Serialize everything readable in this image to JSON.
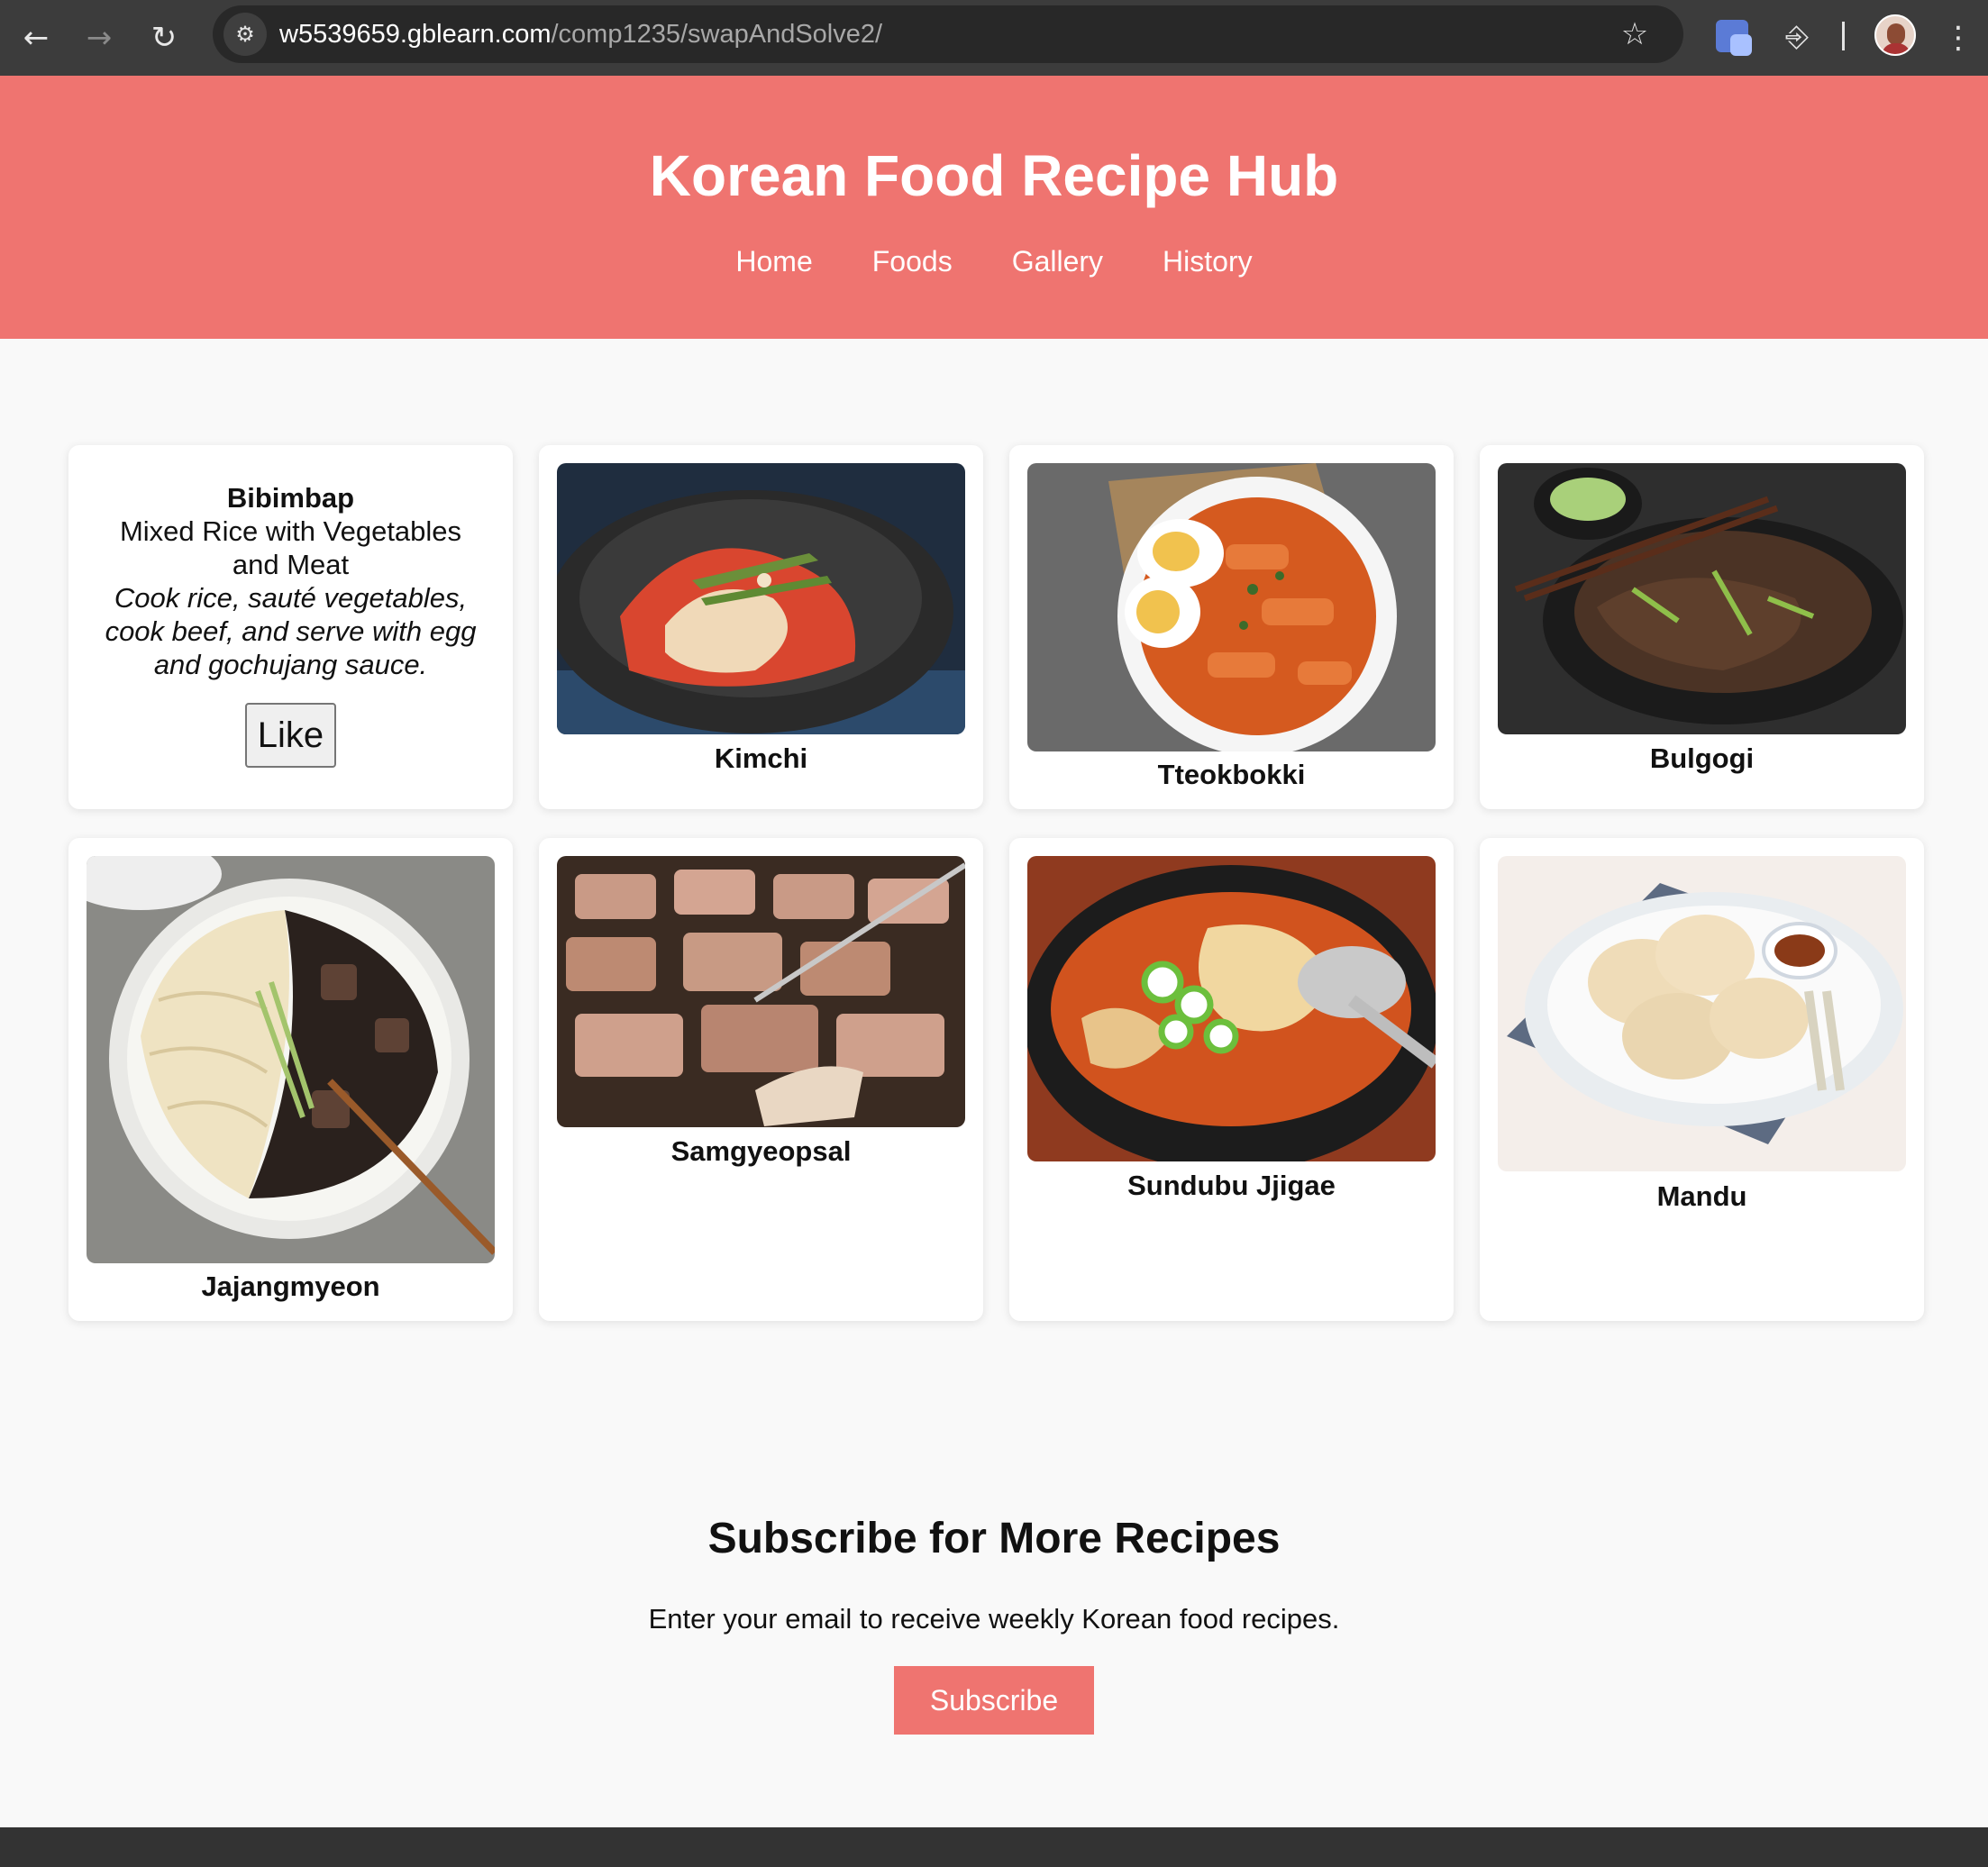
{
  "browser": {
    "url_host": "w5539659.gblearn.com",
    "url_path": "/comp1235/swapAndSolve2/",
    "back_icon": "arrow-left-icon",
    "forward_icon": "arrow-right-icon",
    "reload_icon": "reload-icon",
    "site_info_icon": "tune-icon",
    "bookmark_icon": "star-icon",
    "extensions_icon": "puzzle-icon",
    "menu_icon": "kebab-icon"
  },
  "header": {
    "title": "Korean Food Recipe Hub",
    "nav": [
      "Home",
      "Foods",
      "Gallery",
      "History"
    ],
    "bg_color": "#ef7470"
  },
  "cards": {
    "bibimbap": {
      "title": "Bibimbap",
      "subtitle": "Mixed Rice with Vegetables and Meat",
      "description": "Cook rice, sauté vegetables, cook beef, and serve with egg and gochujang sauce.",
      "like_label": "Like"
    },
    "foods": [
      {
        "name": "Kimchi"
      },
      {
        "name": "Tteokbokki"
      },
      {
        "name": "Bulgogi"
      },
      {
        "name": "Jajangmyeon"
      },
      {
        "name": "Samgyeopsal"
      },
      {
        "name": "Sundubu Jjigae"
      },
      {
        "name": "Mandu"
      }
    ]
  },
  "subscribe": {
    "heading": "Subscribe for More Recipes",
    "text": "Enter your email to receive weekly Korean food recipes.",
    "button_label": "Subscribe"
  }
}
